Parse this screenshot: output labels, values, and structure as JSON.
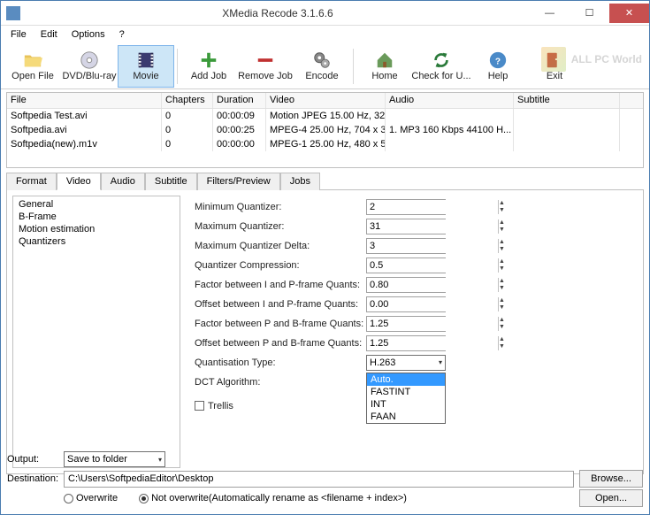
{
  "title": "XMedia Recode 3.1.6.6",
  "menu": {
    "file": "File",
    "edit": "Edit",
    "options": "Options",
    "help": "?"
  },
  "toolbar": {
    "open": "Open File",
    "dvd": "DVD/Blu-ray",
    "movie": "Movie",
    "addjob": "Add Job",
    "removejob": "Remove Job",
    "encode": "Encode",
    "home": "Home",
    "update": "Check for U...",
    "helpbtn": "Help",
    "exit": "Exit"
  },
  "watermark": "ALL PC World",
  "filelist": {
    "headers": {
      "file": "File",
      "chapters": "Chapters",
      "duration": "Duration",
      "video": "Video",
      "audio": "Audio",
      "subtitle": "Subtitle"
    },
    "rows": [
      {
        "file": "Softpedia Test.avi",
        "ch": "0",
        "dur": "00:00:09",
        "vid": "Motion JPEG 15.00 Hz, 32...",
        "aud": "",
        "sub": ""
      },
      {
        "file": "Softpedia.avi",
        "ch": "0",
        "dur": "00:00:25",
        "vid": "MPEG-4 25.00 Hz, 704 x 3...",
        "aud": "1. MP3 160 Kbps 44100 H...",
        "sub": ""
      },
      {
        "file": "Softpedia(new).m1v",
        "ch": "0",
        "dur": "00:00:00",
        "vid": "MPEG-1 25.00 Hz, 480 x 5...",
        "aud": "",
        "sub": ""
      }
    ]
  },
  "tabs": {
    "format": "Format",
    "video": "Video",
    "audio": "Audio",
    "subtitle": "Subtitle",
    "filters": "Filters/Preview",
    "jobs": "Jobs"
  },
  "side": {
    "general": "General",
    "bframe": "B-Frame",
    "motion": "Motion estimation",
    "quant": "Quantizers"
  },
  "form": {
    "minq": {
      "l": "Minimum Quantizer:",
      "v": "2"
    },
    "maxq": {
      "l": "Maximum Quantizer:",
      "v": "31"
    },
    "maxqd": {
      "l": "Maximum Quantizer Delta:",
      "v": "3"
    },
    "qcomp": {
      "l": "Quantizer Compression:",
      "v": "0.5"
    },
    "fip": {
      "l": "Factor between I and P-frame Quants:",
      "v": "0.80"
    },
    "oip": {
      "l": "Offset between I and P-frame Quants:",
      "v": "0.00"
    },
    "fpb": {
      "l": "Factor between P and B-frame Quants:",
      "v": "1.25"
    },
    "opb": {
      "l": "Offset between P and B-frame Quants:",
      "v": "1.25"
    },
    "qtype": {
      "l": "Quantisation Type:",
      "v": "H.263"
    },
    "dct": {
      "l": "DCT Algorithm:",
      "v": "Auto."
    },
    "trellis": "Trellis"
  },
  "dropdown": {
    "o1": "Auto.",
    "o2": "FASTINT",
    "o3": "INT",
    "o4": "FAAN"
  },
  "footer": {
    "output_l": "Output:",
    "output_v": "Save to folder",
    "dest_l": "Destination:",
    "dest_v": "C:\\Users\\SoftpediaEditor\\Desktop",
    "browse": "Browse...",
    "open": "Open...",
    "overwrite": "Overwrite",
    "notoverwrite": "Not overwrite(Automatically rename as <filename + index>)"
  }
}
